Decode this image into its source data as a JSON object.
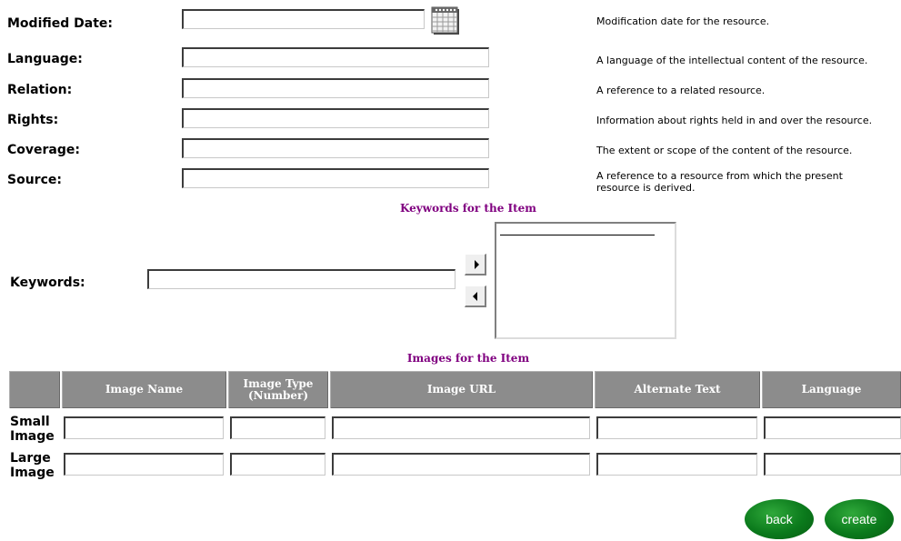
{
  "fields": [
    {
      "key": "modified_date",
      "label": "Modified Date:",
      "description": "Modification date for the resource.",
      "value": ""
    },
    {
      "key": "language",
      "label": "Language:",
      "description": "A language of the intellectual content of the resource.",
      "value": ""
    },
    {
      "key": "relation",
      "label": "Relation:",
      "description": "A reference to a related resource.",
      "value": ""
    },
    {
      "key": "rights",
      "label": "Rights:",
      "description": "Information about rights held in and over the resource.",
      "value": ""
    },
    {
      "key": "coverage",
      "label": "Coverage:",
      "description": "The extent or scope of the content of the resource.",
      "value": ""
    },
    {
      "key": "source",
      "label": "Source:",
      "description_line1": "A reference to a resource from which the present",
      "description_line2": "resource is derived.",
      "value": ""
    }
  ],
  "keywords": {
    "section_title": "Keywords for the Item",
    "label": "Keywords:",
    "value": "",
    "add_icon": "right-triangle-arrow-icon",
    "remove_icon": "left-triangle-arrow-icon",
    "list_items": []
  },
  "images": {
    "section_title": "Images for the Item",
    "columns": [
      "",
      "Image Name",
      "Image Type (Number)",
      "Image URL",
      "Alternate Text",
      "Language"
    ],
    "rows": [
      {
        "label_line1": "Small",
        "label_line2": "Image"
      },
      {
        "label_line1": "Large",
        "label_line2": "Image"
      }
    ]
  },
  "buttons": {
    "back": "back",
    "create": "create"
  },
  "colors": {
    "section_title": "#800080",
    "header_bg": "#8c8c8c",
    "button_green": "#0b7a1c"
  },
  "icons": {
    "calendar": "calendar-icon"
  }
}
